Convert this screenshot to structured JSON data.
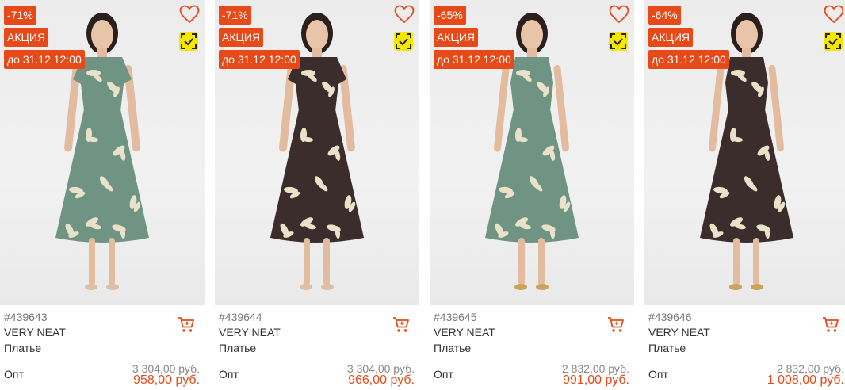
{
  "colors": {
    "badge_bg": "#e64a19",
    "price_color": "#e64a19",
    "scan_badge_bg": "#f5e700",
    "dress_green": "#6f9483",
    "dress_dark": "#3a2d2b"
  },
  "icons": {
    "favorite": "heart-icon",
    "scan": "scan-check-icon",
    "cart": "cart-icon"
  },
  "products": [
    {
      "discount": "-71%",
      "promo": "АКЦИЯ",
      "deadline": "до 31.12 12:00",
      "sku": "#439643",
      "brand": "VERY NEAT",
      "type": "Платье",
      "opt_label": "Опт",
      "old_price": "3 304,00 руб.",
      "price": "958,00 руб.",
      "dress_color": "green",
      "sleeves": true
    },
    {
      "discount": "-71%",
      "promo": "АКЦИЯ",
      "deadline": "до 31.12 12:00",
      "sku": "#439644",
      "brand": "VERY NEAT",
      "type": "Платье",
      "opt_label": "Опт",
      "old_price": "3 304,00 руб.",
      "price": "966,00 руб.",
      "dress_color": "dark",
      "sleeves": true
    },
    {
      "discount": "-65%",
      "promo": "АКЦИЯ",
      "deadline": "до 31.12 12:00",
      "sku": "#439645",
      "brand": "VERY NEAT",
      "type": "Платье",
      "opt_label": "Опт",
      "old_price": "2 832,00 руб.",
      "price": "991,00 руб.",
      "dress_color": "green",
      "sleeves": false
    },
    {
      "discount": "-64%",
      "promo": "АКЦИЯ",
      "deadline": "до 31.12 12:00",
      "sku": "#439646",
      "brand": "VERY NEAT",
      "type": "Платье",
      "opt_label": "Опт",
      "old_price": "2 832,00 руб.",
      "price": "1 008,00 руб.",
      "dress_color": "dark",
      "sleeves": false
    }
  ]
}
